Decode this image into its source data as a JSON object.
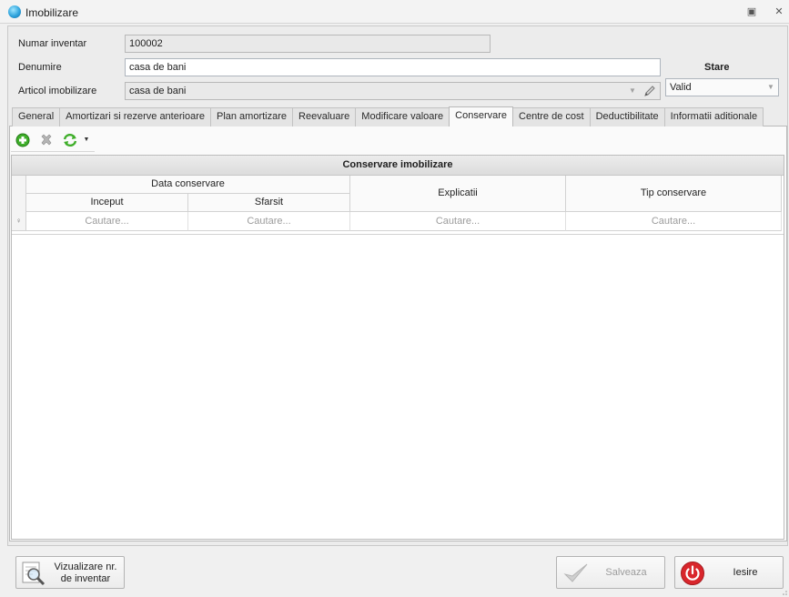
{
  "window": {
    "title": "Imobilizare",
    "icon": "app-globe-icon",
    "restore_glyph": "▣",
    "close_glyph": "✕"
  },
  "form": {
    "inventory_number": {
      "label": "Numar inventar",
      "value": "100002"
    },
    "name": {
      "label": "Denumire",
      "value": "casa de bani"
    },
    "article": {
      "label": "Articol imobilizare",
      "value": "casa de bani"
    },
    "status": {
      "title": "Stare",
      "value": "Valid"
    }
  },
  "tabs": [
    {
      "label": "General",
      "active": false
    },
    {
      "label": "Amortizari si rezerve anterioare",
      "active": false
    },
    {
      "label": "Plan amortizare",
      "active": false
    },
    {
      "label": "Reevaluare",
      "active": false
    },
    {
      "label": "Modificare valoare",
      "active": false
    },
    {
      "label": "Conservare",
      "active": true
    },
    {
      "label": "Centre de cost",
      "active": false
    },
    {
      "label": "Deductibilitate",
      "active": false
    },
    {
      "label": "Informatii aditionale",
      "active": false
    }
  ],
  "toolbar": {
    "buttons": [
      "add-icon",
      "delete-icon",
      "refresh-icon",
      "dropdown-arrow-icon"
    ]
  },
  "grid": {
    "group_title": "Conservare imobilizare",
    "band_label": "Data conservare",
    "columns": {
      "start": "Inceput",
      "end": "Sfarsit",
      "explanations": "Explicatii",
      "type": "Tip conservare"
    },
    "filter_placeholder": "Cautare...",
    "rows": []
  },
  "footer": {
    "view_inventory_label_1": "Vizualizare nr.",
    "view_inventory_label_2": "de inventar",
    "save_label": "Salveaza",
    "save_enabled": false,
    "exit_label": "Iesire"
  },
  "colors": {
    "accent_green": "#3fae2a",
    "exit_red": "#d9262c",
    "panel_bg": "#ececec"
  }
}
